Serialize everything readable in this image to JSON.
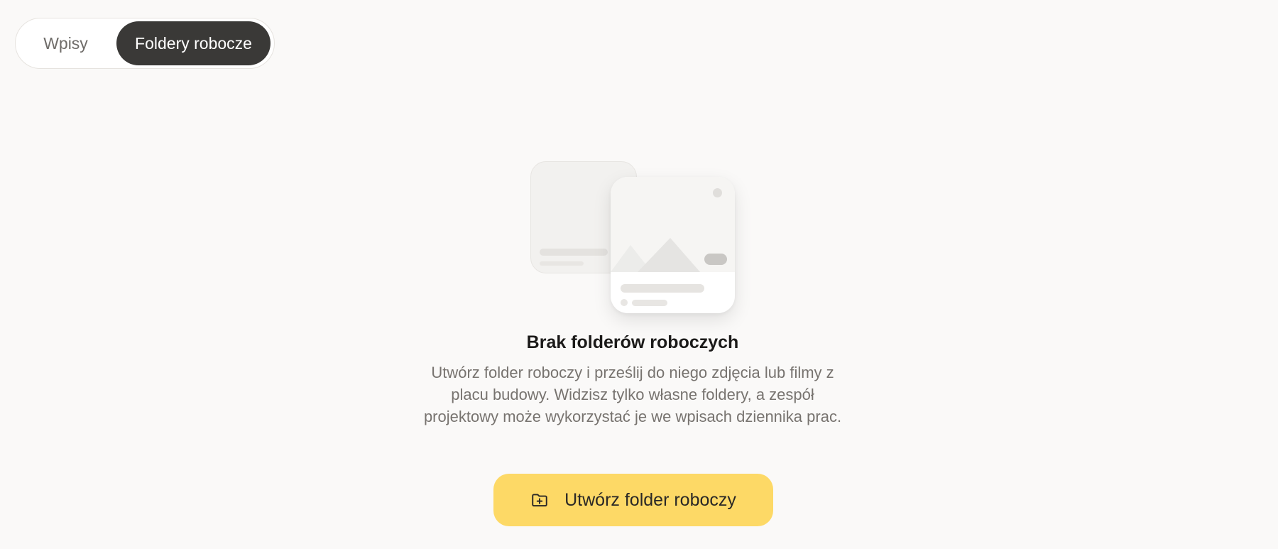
{
  "tabs": {
    "items": [
      {
        "label": "Wpisy",
        "active": false
      },
      {
        "label": "Foldery robocze",
        "active": true
      }
    ]
  },
  "empty_state": {
    "title": "Brak folderów roboczych",
    "description": "Utwórz folder roboczy i prześlij do niego zdjęcia lub filmy z placu budowy. Widzisz tylko własne foldery, a zespół projektowy może wykorzystać je we wpisach dziennika prac.",
    "illustration_icon": "photo-cards-illustration"
  },
  "cta": {
    "label": "Utwórz folder roboczy",
    "icon": "folder-plus-icon",
    "color": "#fdd966"
  },
  "colors": {
    "background": "#faf9f8",
    "active_tab": "#3a3937"
  }
}
